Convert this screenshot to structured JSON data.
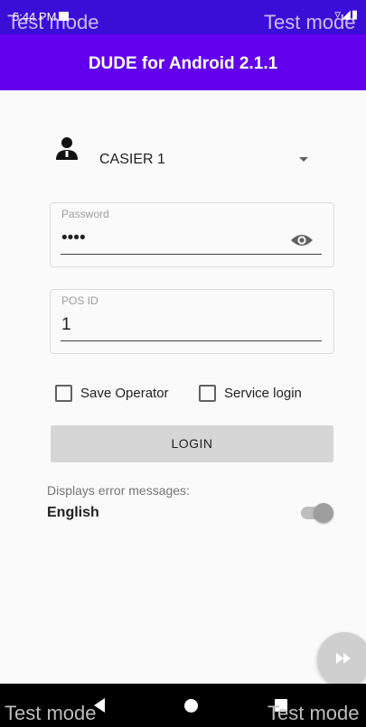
{
  "status_bar": {
    "time": "5:44 PM",
    "icons": "▿◢▮"
  },
  "app_bar": {
    "title": "DUDE for Android 2.1.1"
  },
  "watermark": {
    "text": "Test mode"
  },
  "operator": {
    "name": "CASIER 1"
  },
  "password": {
    "label": "Password",
    "value": "••••"
  },
  "pos_id": {
    "label": "POS ID",
    "value": "1"
  },
  "checkboxes": {
    "save_operator": "Save Operator",
    "service_login": "Service login",
    "save_operator_checked": false,
    "service_login_checked": false
  },
  "login_button": {
    "label": "LOGIN"
  },
  "error_messages": {
    "label": "Displays error messages:",
    "language": "English",
    "toggle_on": false
  },
  "colors": {
    "status_bar": "#3a0ed6",
    "app_bar": "#6200ee",
    "background": "#fafafa",
    "button": "#d6d6d6"
  }
}
